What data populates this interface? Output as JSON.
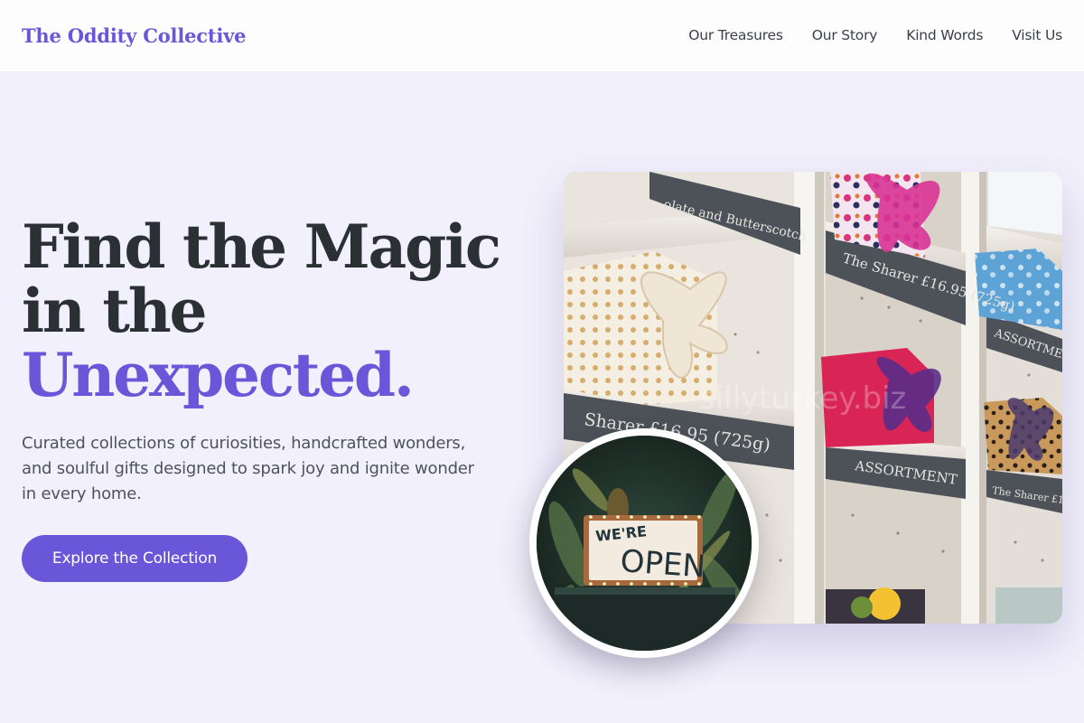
{
  "header": {
    "brand": "The Oddity Collective",
    "nav": [
      "Our Treasures",
      "Our Story",
      "Kind Words",
      "Visit Us"
    ]
  },
  "hero": {
    "headline_line1": "Find the Magic",
    "headline_line2": "in the",
    "headline_accent": "Unexpected.",
    "subtext": "Curated collections of curiosities, handcrafted wonders, and soulful gifts designed to spark joy and ignite wonder in every home.",
    "cta_label": "Explore the Collection"
  },
  "images": {
    "shelf_labels": [
      "olate and Butterscotch",
      "The Sharer £16.95 (725g)",
      "ASSORTMENT",
      "Sharer £16.95 (725g)",
      "ASSORTMENT",
      "The Sharer £16.95"
    ],
    "watermark": "sillyturkey.biz",
    "sign_line1": "WE'RE",
    "sign_line2": "OPEN"
  },
  "colors": {
    "accent": "#6a56d9",
    "page_bg": "#f2f0fc",
    "header_bg": "#fdfdfe",
    "heading": "#2b3035",
    "body_text": "#4e535b"
  }
}
